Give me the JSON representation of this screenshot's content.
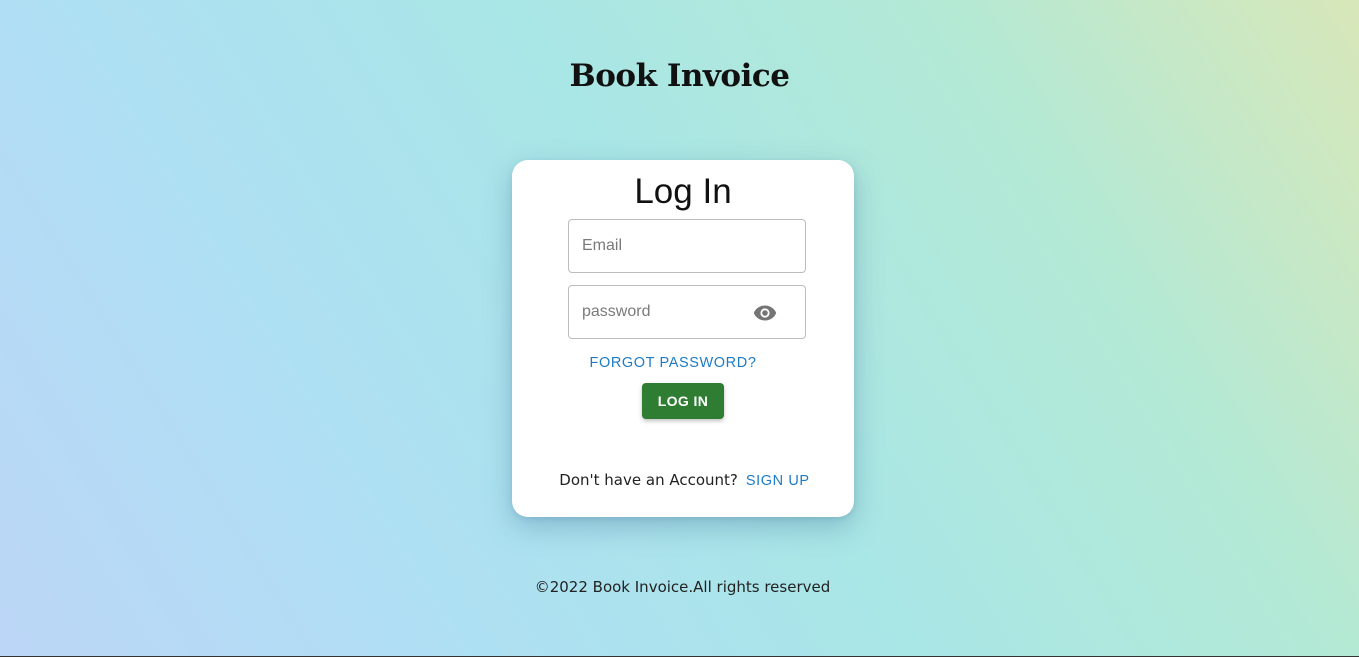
{
  "brand": {
    "title": "Book Invoice"
  },
  "login_card": {
    "title": "Log In",
    "email_placeholder": "Email",
    "password_placeholder": "password",
    "toggle_password_icon": "eye-icon",
    "forgot_password_label": "FORGOT PASSWORD?",
    "login_button_label": "LOG IN",
    "signup_prompt": "Don't have an Account?",
    "signup_link_label": "SIGN UP"
  },
  "footer": {
    "text": "©2022 Book Invoice.All rights reserved"
  },
  "colors": {
    "primary_button": "#2e7d32",
    "link": "#1e7bc4",
    "icon": "#757575"
  }
}
